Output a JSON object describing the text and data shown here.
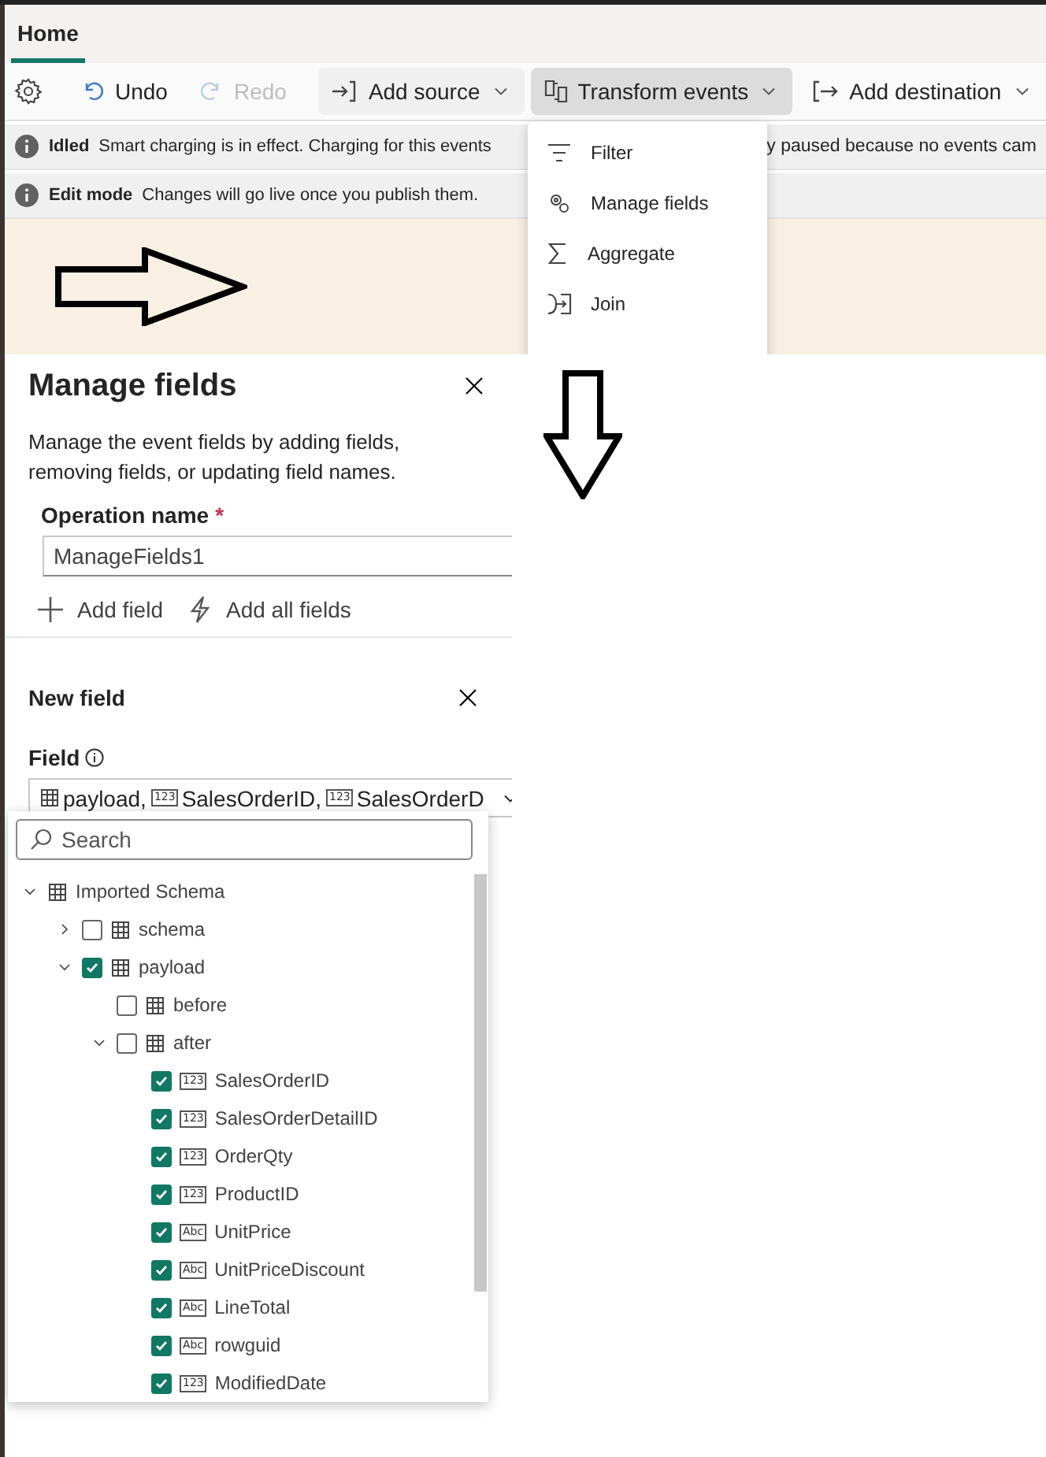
{
  "tabs": [
    {
      "label": "Home",
      "selected": true
    }
  ],
  "toolbar": [
    {
      "kind": "settings"
    },
    {
      "kind": "divider"
    },
    {
      "kind": "undo",
      "label": "Undo",
      "disabled": false
    },
    {
      "kind": "redo",
      "label": "Redo",
      "disabled": true
    },
    {
      "kind": "divider"
    },
    {
      "kind": "source",
      "label": "Add source"
    },
    {
      "kind": "transform",
      "label": "Transform events",
      "expanded": true
    },
    {
      "kind": "destination",
      "label": "Add destination"
    },
    {
      "kind": "divider"
    }
  ],
  "transform_menu": [
    {
      "kind": "filter",
      "label": "Filter"
    },
    {
      "kind": "manage",
      "label": "Manage fields"
    },
    {
      "kind": "aggregate",
      "label": "Aggregate"
    },
    {
      "kind": "join",
      "label": "Join"
    }
  ],
  "banners": [
    {
      "title": "Idled",
      "message": "Smart charging is in effect. Charging for this events",
      "message_after": "y paused because no events cam"
    },
    {
      "title": "Edit mode",
      "message": "Changes will go live once you publish them."
    }
  ],
  "panel": {
    "title": "Manage fields",
    "description": "Manage the event fields by adding fields, removing fields, or updating field names.",
    "operation_label": "Operation name",
    "required_mark": "*",
    "operation_value": "ManageFields1",
    "actions": [
      {
        "kind": "add",
        "label": "Add field"
      },
      {
        "kind": "all",
        "label": "Add all fields"
      }
    ],
    "new_field": {
      "title": "New field",
      "field_label": "Field",
      "value": [
        {
          "kind": "table",
          "text": "payload,"
        },
        {
          "kind": "number",
          "badge": "123",
          "text": "SalesOrderID,"
        },
        {
          "kind": "number",
          "badge": "123",
          "text": "SalesOrderD"
        }
      ]
    }
  },
  "picker": {
    "search": {
      "placeholder": "Search"
    },
    "tree": [
      {
        "label": "Imported Schema",
        "kind": "table",
        "expanded": true,
        "children": [
          {
            "label": "schema",
            "kind": "table",
            "checked": false,
            "expanded": false
          },
          {
            "label": "payload",
            "kind": "table",
            "checked": true,
            "expanded": true,
            "children": [
              {
                "label": "before",
                "kind": "table",
                "checked": false
              },
              {
                "label": "after",
                "kind": "table",
                "checked": false,
                "expanded": true,
                "children": [
                  {
                    "label": "SalesOrderID",
                    "kind": "field",
                    "badge": "123",
                    "checked": true
                  },
                  {
                    "label": "SalesOrderDetailID",
                    "kind": "field",
                    "badge": "123",
                    "checked": true
                  },
                  {
                    "label": "OrderQty",
                    "kind": "field",
                    "badge": "123",
                    "checked": true
                  },
                  {
                    "label": "ProductID",
                    "kind": "field",
                    "badge": "123",
                    "checked": true
                  },
                  {
                    "label": "UnitPrice",
                    "kind": "field",
                    "badge": "Abc",
                    "checked": true
                  },
                  {
                    "label": "UnitPriceDiscount",
                    "kind": "field",
                    "badge": "Abc",
                    "checked": true
                  },
                  {
                    "label": "LineTotal",
                    "kind": "field",
                    "badge": "Abc",
                    "checked": true
                  },
                  {
                    "label": "rowguid",
                    "kind": "field",
                    "badge": "Abc",
                    "checked": true
                  },
                  {
                    "label": "ModifiedDate",
                    "kind": "field",
                    "badge": "123",
                    "checked": true
                  }
                ]
              }
            ]
          }
        ]
      }
    ]
  }
}
